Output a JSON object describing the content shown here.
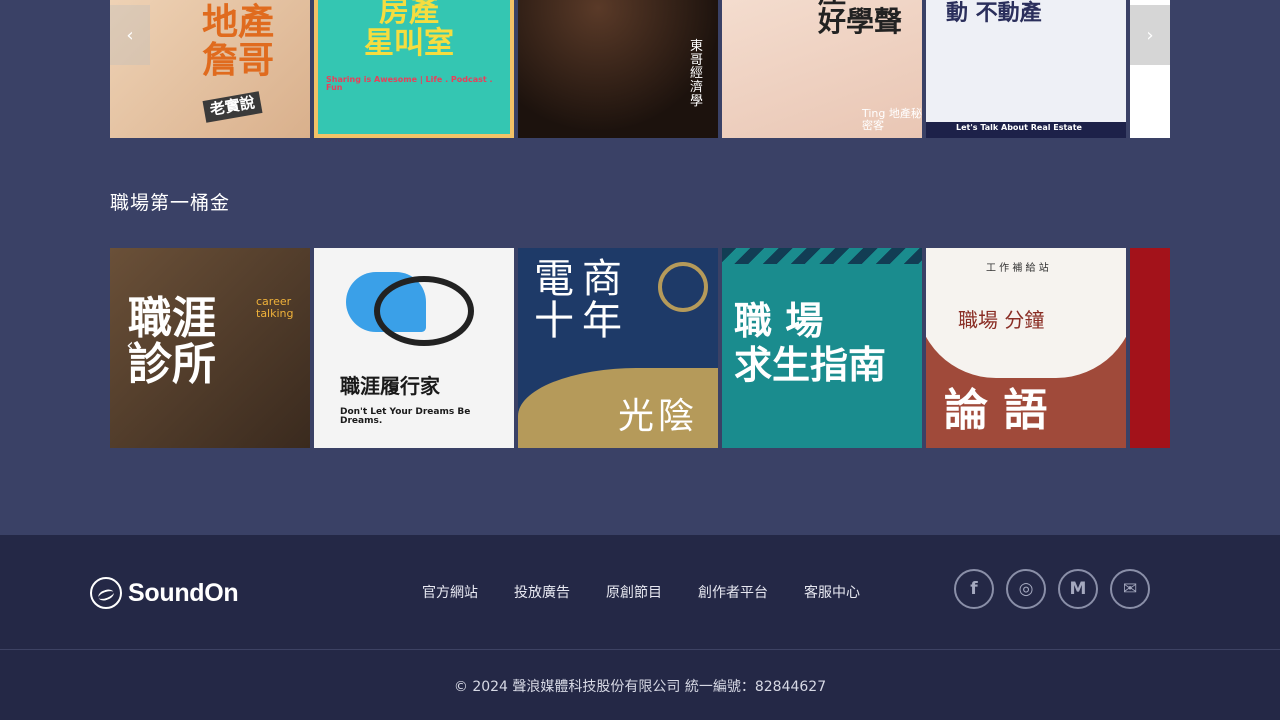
{
  "rows": [
    {
      "title": "",
      "cards": [
        {
          "caption": "地產\n詹哥",
          "sub": "老實說",
          "bg": "#e9c7a0",
          "fg": "#e06b1e"
        },
        {
          "caption": "房產\n星叫室",
          "sub": "Sharing is Awesome | Life . Podcast . Fun",
          "bg": "#34c6b2",
          "fg": "#f5dd3f"
        },
        {
          "caption": "東\n哥\n經\n濟\n學",
          "sub": "",
          "bg": "#2a1a14",
          "fg": "#ffffff"
        },
        {
          "caption": "產\n好學聲",
          "sub": "Ting 地產秘密客",
          "bg": "#f1d7c8",
          "fg": "#222222"
        },
        {
          "caption": "動 不動產",
          "sub": "Let's Talk About Real Estate",
          "bg": "#e8eaf3",
          "fg": "#2b2f5c"
        }
      ]
    },
    {
      "title": "職場第一桶金",
      "cards": [
        {
          "caption": "職涯\n診所",
          "sub": "career talking",
          "bg": "#5a4432",
          "fg": "#ffffff"
        },
        {
          "caption": "職涯履行家",
          "sub": "Don't Let Your Dreams Be Dreams.",
          "bg": "#f3f3f3",
          "fg": "#1a1a1a"
        },
        {
          "caption": "電商\n十年",
          "sub": "光陰",
          "bg": "#1e3a68",
          "fg": "#ffffff"
        },
        {
          "caption": "職 場\n求生指南",
          "sub": "",
          "bg": "#1a8c8e",
          "fg": "#ffffff"
        },
        {
          "caption": "職場 分鐘",
          "sub": "論 語",
          "top": "工 作 補 給 站",
          "bg": "#a04a3a",
          "fg": "#ffffff"
        }
      ]
    }
  ],
  "nav": {
    "prev": "‹",
    "next": "›"
  },
  "footer": {
    "logo_text": "SoundOn",
    "links": [
      "官方網站",
      "投放廣告",
      "原創節目",
      "創作者平台",
      "客服中心"
    ],
    "socials": [
      "facebook-icon",
      "instagram-icon",
      "medium-icon",
      "mail-icon"
    ],
    "social_glyphs": [
      "f",
      "◎",
      "M",
      "✉"
    ],
    "copyright": "© 2024 聲浪媒體科技股份有限公司 統一編號：82844627"
  }
}
